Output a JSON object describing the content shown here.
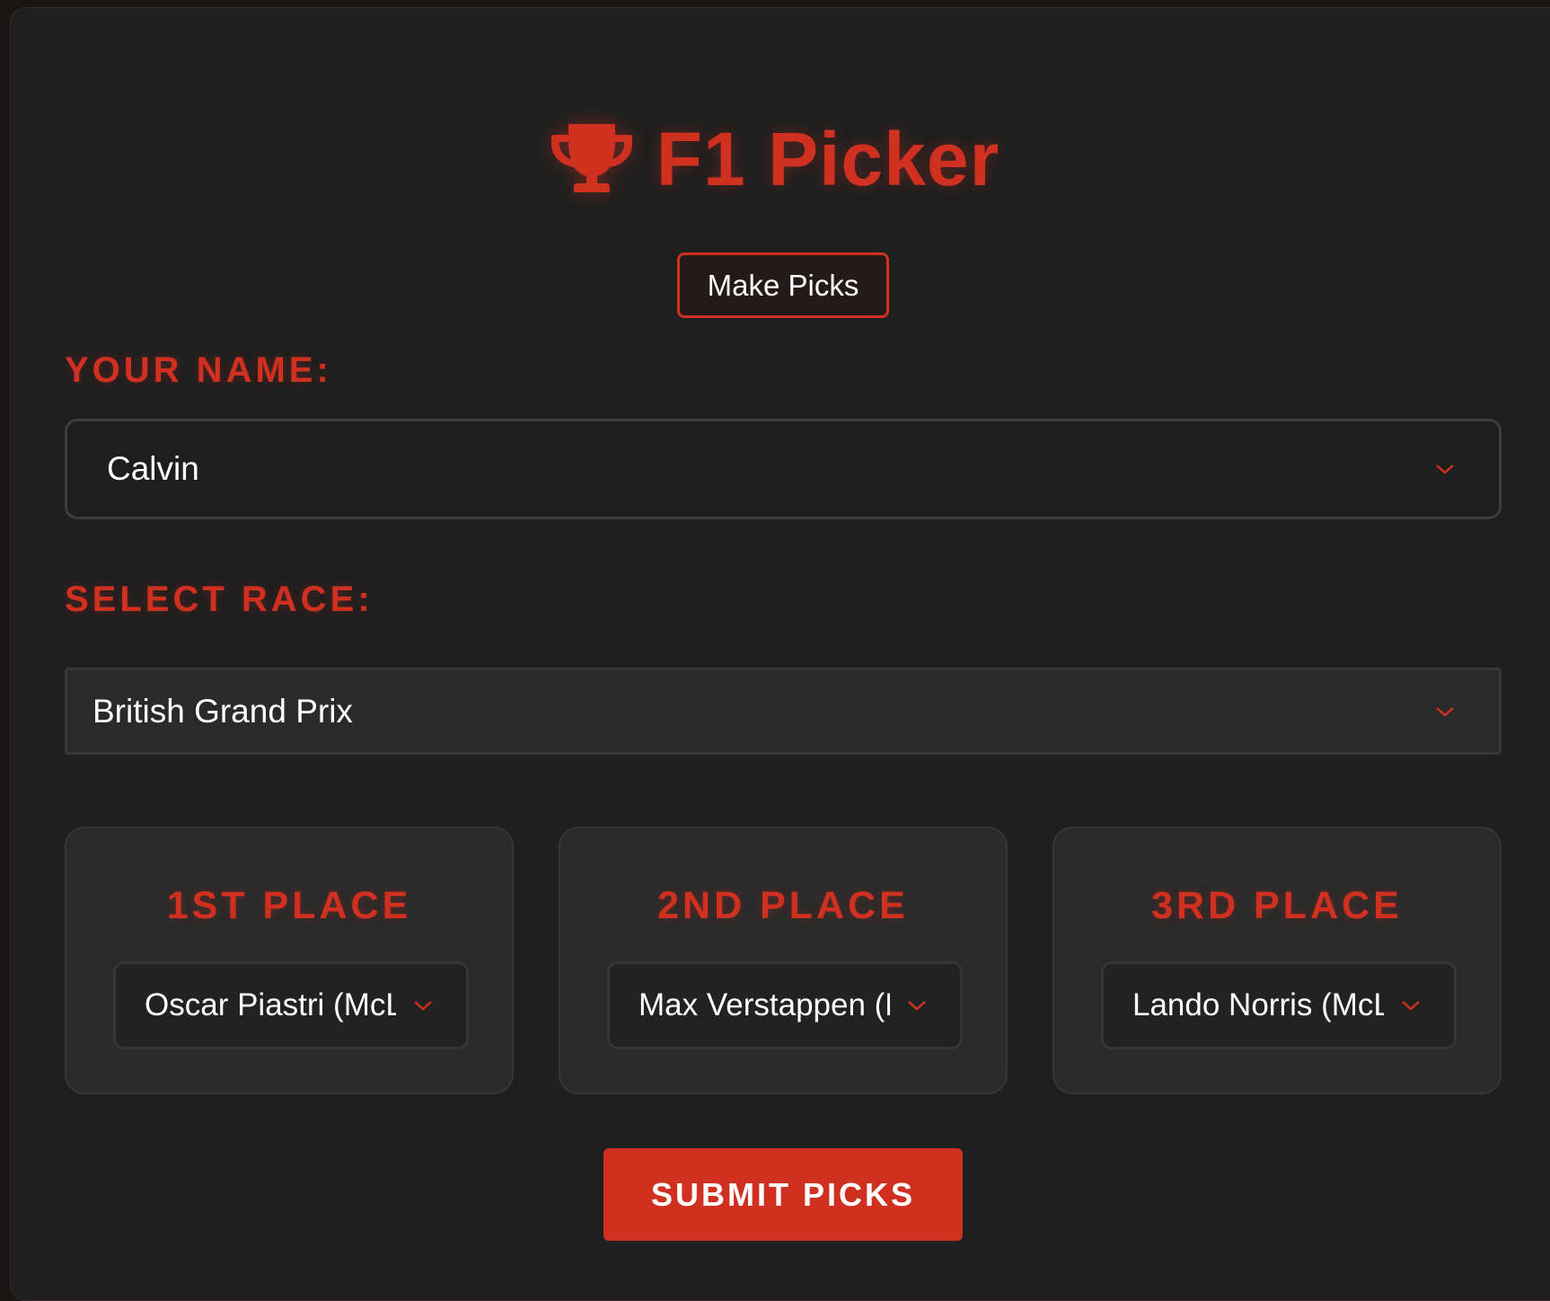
{
  "app": {
    "title": "F1 Picker",
    "icon": "trophy-icon"
  },
  "nav": {
    "make_picks_label": "Make Picks"
  },
  "form": {
    "name_label": "YOUR NAME:",
    "name_value": "Calvin",
    "race_label": "SELECT RACE:",
    "race_value": "British Grand Prix"
  },
  "places": [
    {
      "title": "1ST PLACE",
      "driver": "Oscar Piastri (McLaren)"
    },
    {
      "title": "2ND PLACE",
      "driver": "Max Verstappen (Red Bull)"
    },
    {
      "title": "3RD PLACE",
      "driver": "Lando Norris (McLaren)"
    }
  ],
  "actions": {
    "submit_label": "SUBMIT PICKS"
  },
  "colors": {
    "accent": "#d03020",
    "background": "#1f1f1f",
    "card": "#2a2a2a",
    "text": "#ffffff"
  }
}
